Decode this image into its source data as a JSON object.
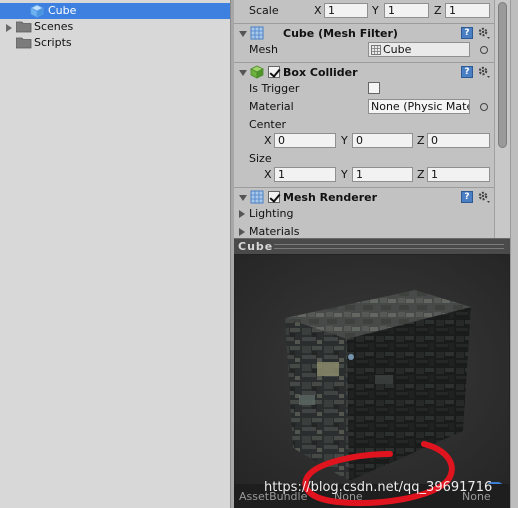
{
  "project": {
    "items": [
      {
        "label": "Cube",
        "selected": true,
        "icon": "prefab-cube-icon"
      },
      {
        "label": "Scenes",
        "selected": false,
        "icon": "folder-icon"
      },
      {
        "label": "Scripts",
        "selected": false,
        "icon": "folder-icon"
      }
    ]
  },
  "transform": {
    "scale_label": "Scale",
    "scale": {
      "x_label": "X",
      "x": "1",
      "y_label": "Y",
      "y": "1",
      "z_label": "Z",
      "z": "1"
    }
  },
  "mesh_filter": {
    "title": "Cube (Mesh Filter)",
    "mesh_label": "Mesh",
    "mesh_value": "Cube"
  },
  "box_collider": {
    "title": "Box Collider",
    "enabled": true,
    "is_trigger_label": "Is Trigger",
    "is_trigger": false,
    "material_label": "Material",
    "material_value": "None (Physic Mate",
    "center_label": "Center",
    "center": {
      "x_label": "X",
      "x": "0",
      "y_label": "Y",
      "y": "0",
      "z_label": "Z",
      "z": "0"
    },
    "size_label": "Size",
    "size": {
      "x_label": "X",
      "x": "1",
      "y_label": "Y",
      "y": "1",
      "z_label": "Z",
      "z": "1"
    }
  },
  "mesh_renderer": {
    "title": "Mesh Renderer",
    "enabled": true,
    "lighting_label": "Lighting",
    "materials_label": "Materials"
  },
  "preview": {
    "title": "Cube",
    "assetbundle_label": "AssetBundle",
    "assetbundle_value": "None",
    "variant_value": "None"
  },
  "watermark": "https://blog.csdn.net/qq_39691716",
  "colors": {
    "selection": "#3d80df",
    "annotation": "#e0141e",
    "preview_bg": "#2c2c2c"
  }
}
